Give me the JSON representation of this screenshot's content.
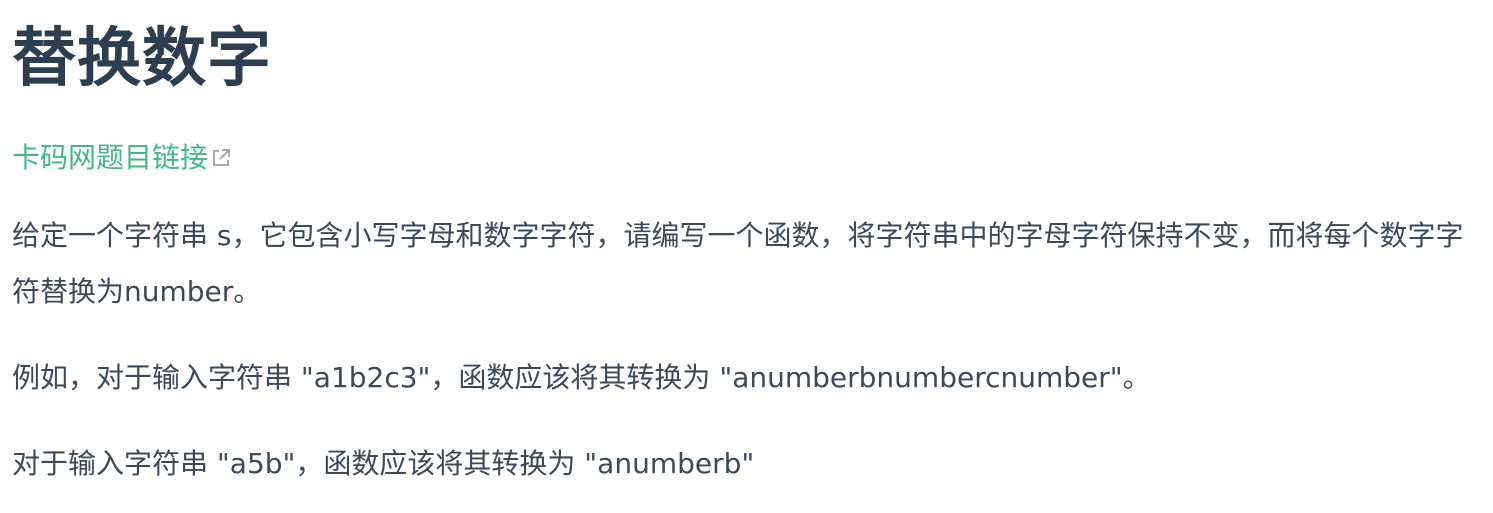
{
  "title": "替换数字",
  "link": {
    "label": "卡码网题目链接",
    "icon": "external-link-icon",
    "color": "#42b983"
  },
  "paragraphs": {
    "p1": "给定一个字符串 s，它包含小写字母和数字字符，请编写一个函数，将字符串中的字母字符保持不变，而将每个数字字符替换为number。",
    "p2": "例如，对于输入字符串 \"a1b2c3\"，函数应该将其转换为 \"anumberbnumbercnumber\"。",
    "p3": "对于输入字符串 \"a5b\"，函数应该将其转换为 \"anumberb\""
  }
}
